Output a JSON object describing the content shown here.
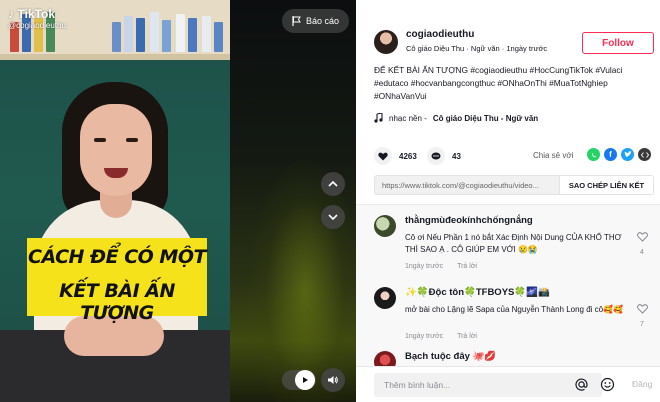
{
  "video": {
    "logo_text": "TikTok",
    "watermark_handle": "@cogiaodieuthu",
    "caption_line1": "CÁCH ĐỂ CÓ MỘT",
    "caption_line2": "KẾT BÀI ẤN TƯỢNG",
    "report_label": "Báo cáo"
  },
  "author": {
    "username": "cogiaodieuthu",
    "display_line": "Cô giáo Diệu Thu · Ngữ văn · 1ngày trước",
    "follow_label": "Follow"
  },
  "description": {
    "text": "ĐỂ KẾT BÀI ẤN TƯỢNG #cogiaodieuthu #HocCungTikTok #Vulaci #edutaco #hocvanbangcongthuc #ONhaOnThi #MuaTotNghiep #ONhaVanVui"
  },
  "music": {
    "prefix": "nhạc nền -",
    "title": "Cô giáo Diệu Thu - Ngữ văn"
  },
  "stats": {
    "likes": "4263",
    "comments": "43",
    "share_label": "Chia sẻ với"
  },
  "link": {
    "url": "https://www.tiktok.com/@cogiaodieuthu/video...",
    "copy_label": "SAO CHÉP LIÊN KẾT"
  },
  "comments": [
    {
      "name": "thằngmùđeokínhchốngnắng",
      "text": "Cô ơi Nếu Phần 1 nó bắt Xác Định Nội Dung CỦA KHỔ THƠ THÌ SAO Ạ . CÔ GIÚP EM VỚI 😢😭",
      "time": "1ngày trước",
      "reply": "Trả lời",
      "likes": "4"
    },
    {
      "name": "✨🍀Độc tôn🍀TFBOYS🍀🌌📸",
      "text": "mở bài cho Lặng lẽ Sapa của Nguyễn Thành Long đi cô🥰🥰",
      "time": "1ngày trước",
      "reply": "Trả lời",
      "likes": "7"
    },
    {
      "name": "Bạch tuộc đây 🐙💋",
      "text": "",
      "time": "",
      "reply": "",
      "likes": ""
    }
  ],
  "composer": {
    "placeholder": "Thêm bình luận...",
    "post_label": "Đăng"
  },
  "colors": {
    "accent": "#fe2c55",
    "caption_bg": "#f5e21a",
    "whatsapp": "#25d366",
    "facebook": "#1877f2",
    "twitter": "#1da1f2",
    "embed": "#3a3a3a"
  }
}
